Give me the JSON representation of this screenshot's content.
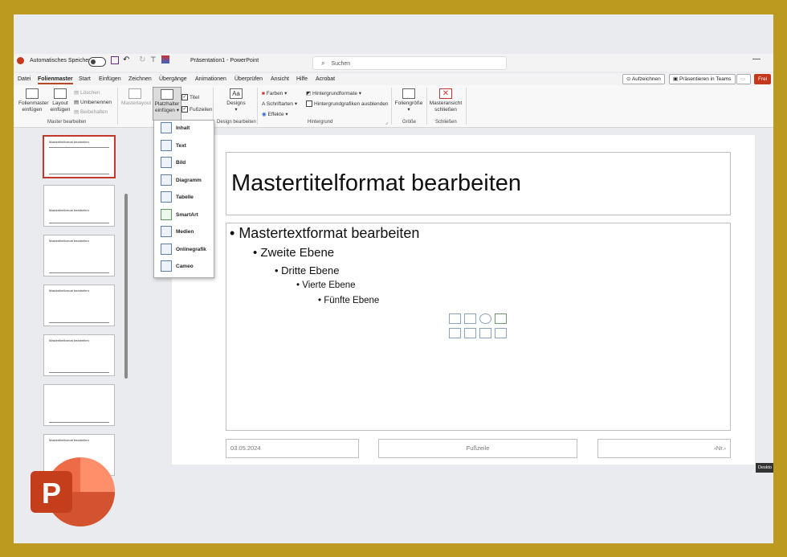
{
  "titlebar": {
    "autosave_label": "Automatisches Speichern",
    "doc_title": "Präsentation1 - PowerPoint",
    "search_placeholder": "Suchen"
  },
  "menu": {
    "tabs": [
      "Datei",
      "Folienmaster",
      "Start",
      "Einfügen",
      "Zeichnen",
      "Übergänge",
      "Animationen",
      "Überprüfen",
      "Ansicht",
      "Hilfe",
      "Acrobat"
    ],
    "record": "Aufzeichnen",
    "present_teams": "Präsentieren in Teams",
    "share": "Frei"
  },
  "ribbon": {
    "master_edit": {
      "insert_master": "Folienmaster einfügen",
      "insert_layout": "Layout einfügen",
      "delete": "Löschen",
      "rename": "Umbenennen",
      "keep": "Beibehalten",
      "group": "Master bearbeiten"
    },
    "masterlayout": "Masterlayout",
    "placeholder": "Platzhalter einfügen",
    "title_check": "Titel",
    "footer_check": "Fußzeilen",
    "designs": "Designs",
    "design_group": "Design bearbeiten",
    "colors": "Farben",
    "fonts": "Schriftarten",
    "effects": "Effekte",
    "bg_formats": "Hintergrundformate",
    "hide_bg": "Hintergrundgrafiken ausblenden",
    "bg_group": "Hintergrund",
    "slide_size": "Foliengröße",
    "size_group": "Größe",
    "close_master": "Masteransicht schließen",
    "close_group": "Schließen"
  },
  "dropdown": {
    "items": [
      "Inhalt",
      "Text",
      "Bild",
      "Diagramm",
      "Tabelle",
      "SmartArt",
      "Medien",
      "Onlinegrafik",
      "Cameo"
    ]
  },
  "thumbnails": [
    {
      "title": "Mastertitelformat bearbeiten"
    },
    {
      "title": "Mastertitelformat bearbeiten"
    },
    {
      "title": "Mastertitelformat bearbeiten"
    },
    {
      "title": "Mastertitelformat bearbeiten"
    },
    {
      "title": "Mastertitelformat bearbeiten"
    },
    {
      "title": ""
    },
    {
      "title": "Mastertitelformat bearbeiten"
    }
  ],
  "slide": {
    "title": "Mastertitelformat bearbeiten",
    "level1": "Mastertextformat bearbeiten",
    "level2": "Zweite Ebene",
    "level3": "Dritte Ebene",
    "level4": "Vierte Ebene",
    "level5": "Fünfte Ebene",
    "date": "03.05.2024",
    "footer": "Fußzeile",
    "number": "‹Nr.›"
  },
  "status": {
    "desktop": "Deskto"
  },
  "colors": {
    "accent": "#b7472a",
    "frame": "#bb9a1f"
  }
}
